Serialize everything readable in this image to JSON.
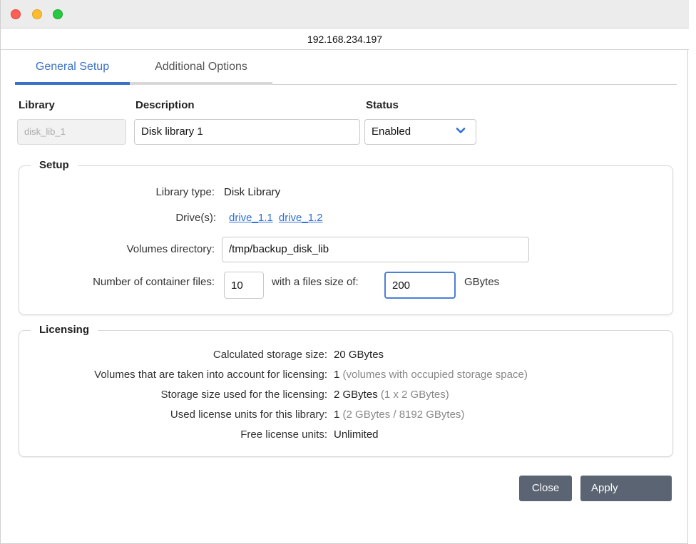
{
  "window": {
    "address": "192.168.234.197"
  },
  "tabs": [
    {
      "label": "General Setup",
      "active": true
    },
    {
      "label": "Additional Options",
      "active": false
    }
  ],
  "header": {
    "library_label": "Library",
    "library_value": "disk_lib_1",
    "description_label": "Description",
    "description_value": "Disk library 1",
    "status_label": "Status",
    "status_value": "Enabled",
    "status_icon": "chevron-down-icon"
  },
  "setup": {
    "legend": "Setup",
    "library_type_label": "Library type:",
    "library_type_value": "Disk Library",
    "drives_label": "Drive(s):",
    "drives": [
      "drive_1.1",
      "drive_1.2"
    ],
    "volumes_dir_label": "Volumes directory:",
    "volumes_dir_value": "/tmp/backup_disk_lib",
    "container_files_label": "Number of container files:",
    "container_files_value": "10",
    "file_size_label": "with a files size of:",
    "file_size_value": "200",
    "file_size_unit": "GBytes"
  },
  "licensing": {
    "legend": "Licensing",
    "rows": [
      {
        "label": "Calculated storage size:",
        "value": "20 GBytes",
        "note": ""
      },
      {
        "label": "Volumes that are taken into account for licensing:",
        "value": "1",
        "note": "(volumes with occupied storage space)"
      },
      {
        "label": "Storage size used for the licensing:",
        "value": "2 GBytes",
        "note": "(1 x 2 GBytes)"
      },
      {
        "label": "Used license units for this library:",
        "value": "1",
        "note": "(2 GBytes / 8192 GBytes)"
      },
      {
        "label": "Free license units:",
        "value": "Unlimited",
        "note": ""
      }
    ]
  },
  "buttons": {
    "close": "Close",
    "apply": "Apply"
  },
  "colors": {
    "accent": "#3a72c8",
    "button": "#5a6472",
    "link": "#2f6fd6",
    "traffic_close": "#fe5f57",
    "traffic_min": "#febc2e",
    "traffic_max": "#28c840"
  }
}
